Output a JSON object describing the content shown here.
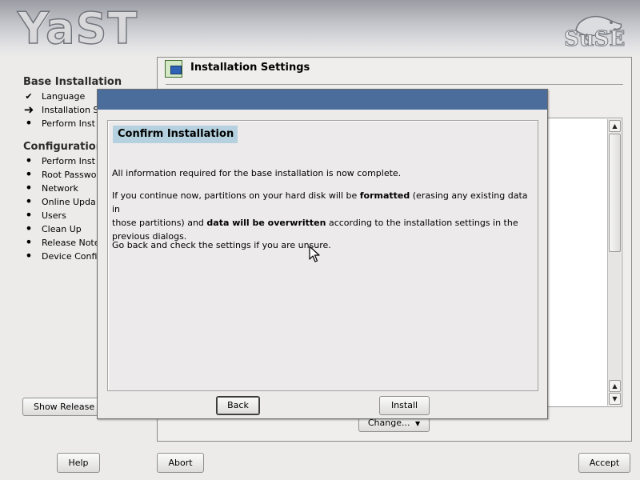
{
  "header": {
    "logo_text": "YaST",
    "brand_text": "SuSE"
  },
  "sidebar": {
    "sections": [
      {
        "title": "Base Installation",
        "items": [
          {
            "label": "Language",
            "status": "done"
          },
          {
            "label": "Installation S",
            "status": "current"
          },
          {
            "label": "Perform Inst",
            "status": "pending"
          }
        ]
      },
      {
        "title": "Configuration",
        "items": [
          {
            "label": "Perform Inst",
            "status": "pending"
          },
          {
            "label": "Root Passwo",
            "status": "pending"
          },
          {
            "label": "Network",
            "status": "pending"
          },
          {
            "label": "Online Upda",
            "status": "pending"
          },
          {
            "label": "Users",
            "status": "pending"
          },
          {
            "label": "Clean Up",
            "status": "pending"
          },
          {
            "label": "Release Note",
            "status": "pending"
          },
          {
            "label": "Device Confi",
            "status": "pending"
          }
        ]
      }
    ],
    "show_release_label": "Show Release"
  },
  "main": {
    "title": "Installation Settings",
    "change_label": "Change..."
  },
  "footer": {
    "help_label": "Help",
    "abort_label": "Abort",
    "accept_label": "Accept"
  },
  "dialog": {
    "heading": "Confirm Installation",
    "line1": "All information required for the base installation is now complete.",
    "para2_a": "If you continue now, partitions on your hard disk will be ",
    "para2_b": "formatted",
    "para2_c": " (erasing any existing data in",
    "para2_d": "those partitions) and ",
    "para2_e": "data will be overwritten",
    "para2_f": " according to the installation settings in the",
    "para2_g": "previous dialogs.",
    "line3": "Go back and check the settings if you are unsure.",
    "back_label": "Back",
    "install_label": "Install"
  },
  "icons": {
    "done": "check-icon",
    "current": "arrow-right-icon",
    "pending": "bullet-icon"
  }
}
